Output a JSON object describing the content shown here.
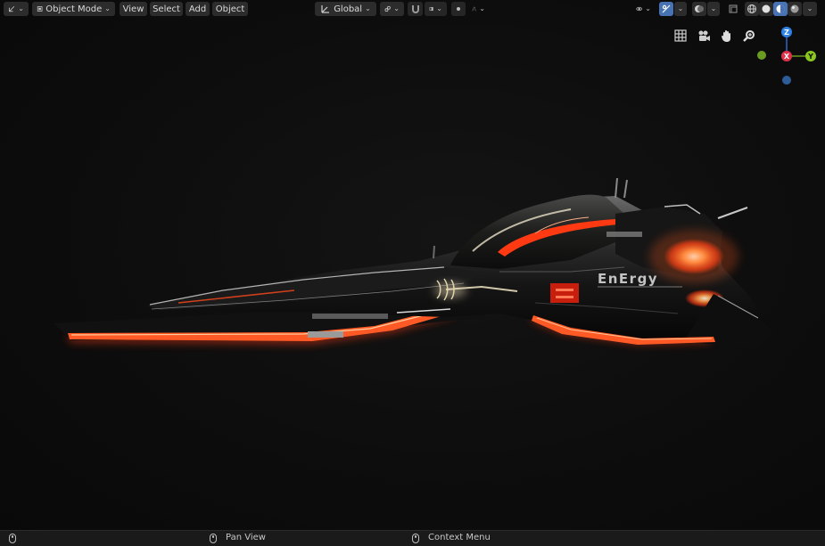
{
  "header": {
    "editor_type_icon": "transform-axes-icon",
    "mode": "Object Mode",
    "menus": [
      "View",
      "Select",
      "Add",
      "Object"
    ],
    "transform_orientation": "Global",
    "snap_icon": "magnet-icon",
    "pivot_icon": "link-icon"
  },
  "viewport": {
    "nav_icons": [
      "grid-icon",
      "camera-icon",
      "hand-icon",
      "zoom-icon"
    ],
    "gizmo": {
      "z": "Z",
      "x": "X",
      "y": "Y"
    },
    "ship_decal": "EnErgy",
    "colors": {
      "glow": "#ff3a12",
      "chrome": "#8a8a8a",
      "background": "#0b0b0b",
      "accent": "#4772b3"
    }
  },
  "statusbar": {
    "pan_view": "Pan View",
    "context_menu": "Context Menu"
  }
}
